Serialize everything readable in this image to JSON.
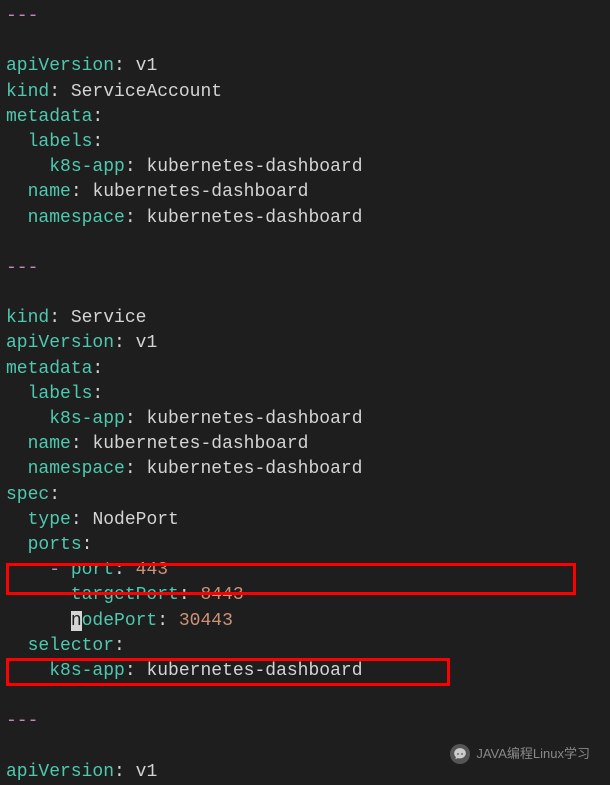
{
  "code": {
    "sep": "---",
    "block1": {
      "l1_key": "apiVersion",
      "l1_val": " v1",
      "l2_key": "kind",
      "l2_val": " ServiceAccount",
      "l3_key": "metadata",
      "l3_colon": ":",
      "l4_key": "labels",
      "l4_colon": ":",
      "l5_key": "k8s-app",
      "l5_val": " kubernetes-dashboard",
      "l6_key": "name",
      "l6_val": " kubernetes-dashboard",
      "l7_key": "namespace",
      "l7_val": " kubernetes-dashboard"
    },
    "block2": {
      "l1_key": "kind",
      "l1_val": " Service",
      "l2_key": "apiVersion",
      "l2_val": " v1",
      "l3_key": "metadata",
      "l3_colon": ":",
      "l4_key": "labels",
      "l4_colon": ":",
      "l5_key": "k8s-app",
      "l5_val": " kubernetes-dashboard",
      "l6_key": "name",
      "l6_val": " kubernetes-dashboard",
      "l7_key": "namespace",
      "l7_val": " kubernetes-dashboard",
      "l8_key": "spec",
      "l8_colon": ":",
      "l9_key": "type",
      "l9_val": " NodePort",
      "l10_key": "ports",
      "l10_colon": ":",
      "l11_dash": "- ",
      "l11_key": "port",
      "l11_val": " 443",
      "l12_key": "targetPort",
      "l12_val": " 8443",
      "l13_cursor": "n",
      "l13_key": "odePort",
      "l13_val": " 30443",
      "l14_key": "selector",
      "l14_colon": ":",
      "l15_key": "k8s-app",
      "l15_val": " kubernetes-dashboard"
    },
    "block3": {
      "l1_key": "apiVersion",
      "l1_val": " v1"
    }
  },
  "watermark": {
    "text": "JAVA编程Linux学习"
  },
  "chart_data": {
    "type": "table",
    "description": "Kubernetes YAML configuration for dashboard ServiceAccount and Service with highlighted NodePort configuration",
    "highlighted_fields": [
      {
        "key": "type",
        "value": "NodePort"
      },
      {
        "key": "nodePort",
        "value": 30443
      }
    ],
    "service_ports": {
      "port": 443,
      "targetPort": 8443,
      "nodePort": 30443
    }
  }
}
